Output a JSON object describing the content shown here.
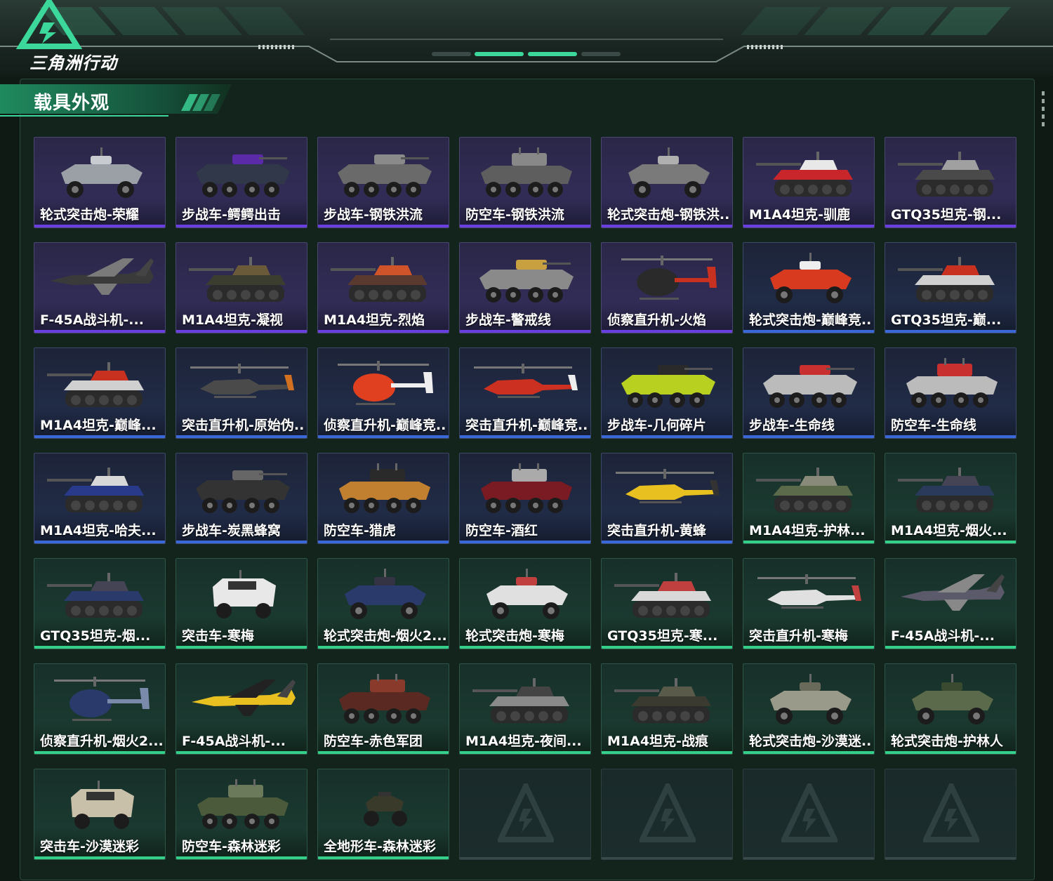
{
  "header": {
    "logo_text": "三角洲行动",
    "section_title": "载具外观"
  },
  "colors": {
    "rarity_purple": "#6a3fe0",
    "rarity_blue": "#3a68d8",
    "rarity_green": "#34d08a",
    "accent": "#3cd79a"
  },
  "items": [
    {
      "label": "轮式突击炮-荣耀",
      "rarity": "purple",
      "icon": "wheeled-assault-gun-icon"
    },
    {
      "label": "步战车-鳄鳄出击",
      "rarity": "purple",
      "icon": "ifv-icon"
    },
    {
      "label": "步战车-钢铁洪流",
      "rarity": "purple",
      "icon": "ifv-icon"
    },
    {
      "label": "防空车-钢铁洪流",
      "rarity": "purple",
      "icon": "aa-vehicle-icon"
    },
    {
      "label": "轮式突击炮-钢铁洪...",
      "rarity": "purple",
      "icon": "wheeled-assault-gun-icon"
    },
    {
      "label": "M1A4坦克-驯鹿",
      "rarity": "purple",
      "icon": "tank-icon"
    },
    {
      "label": "GTQ35坦克-钢...",
      "rarity": "purple",
      "icon": "tank-icon"
    },
    {
      "label": "F-45A战斗机-...",
      "rarity": "purple",
      "icon": "jet-icon"
    },
    {
      "label": "M1A4坦克-凝视",
      "rarity": "purple",
      "icon": "tank-icon"
    },
    {
      "label": "M1A4坦克-烈焰",
      "rarity": "purple",
      "icon": "tank-icon"
    },
    {
      "label": "步战车-警戒线",
      "rarity": "purple",
      "icon": "ifv-icon"
    },
    {
      "label": "侦察直升机-火焰",
      "rarity": "purple",
      "icon": "scout-helicopter-icon"
    },
    {
      "label": "轮式突击炮-巅峰竞...",
      "rarity": "blue",
      "icon": "wheeled-assault-gun-icon"
    },
    {
      "label": "GTQ35坦克-巅...",
      "rarity": "blue",
      "icon": "tank-icon"
    },
    {
      "label": "M1A4坦克-巅峰...",
      "rarity": "blue",
      "icon": "tank-icon"
    },
    {
      "label": "突击直升机-原始伪...",
      "rarity": "blue",
      "icon": "attack-helicopter-icon"
    },
    {
      "label": "侦察直升机-巅峰竞...",
      "rarity": "blue",
      "icon": "scout-helicopter-icon"
    },
    {
      "label": "突击直升机-巅峰竞...",
      "rarity": "blue",
      "icon": "attack-helicopter-icon"
    },
    {
      "label": "步战车-几何碎片",
      "rarity": "blue",
      "icon": "ifv-icon"
    },
    {
      "label": "步战车-生命线",
      "rarity": "blue",
      "icon": "ifv-icon"
    },
    {
      "label": "防空车-生命线",
      "rarity": "blue",
      "icon": "aa-vehicle-icon"
    },
    {
      "label": "M1A4坦克-哈夫...",
      "rarity": "blue",
      "icon": "tank-icon"
    },
    {
      "label": "步战车-炭黑蜂窝",
      "rarity": "blue",
      "icon": "ifv-icon"
    },
    {
      "label": "防空车-猎虎",
      "rarity": "blue",
      "icon": "aa-vehicle-icon"
    },
    {
      "label": "防空车-酒红",
      "rarity": "blue",
      "icon": "aa-vehicle-icon"
    },
    {
      "label": "突击直升机-黄蜂",
      "rarity": "blue",
      "icon": "attack-helicopter-icon"
    },
    {
      "label": "M1A4坦克-护林...",
      "rarity": "green",
      "icon": "tank-icon"
    },
    {
      "label": "M1A4坦克-烟火...",
      "rarity": "green",
      "icon": "tank-icon"
    },
    {
      "label": "GTQ35坦克-烟...",
      "rarity": "green",
      "icon": "tank-icon"
    },
    {
      "label": "突击车-寒梅",
      "rarity": "green",
      "icon": "assault-vehicle-icon"
    },
    {
      "label": "轮式突击炮-烟火2...",
      "rarity": "green",
      "icon": "wheeled-assault-gun-icon"
    },
    {
      "label": "轮式突击炮-寒梅",
      "rarity": "green",
      "icon": "wheeled-assault-gun-icon"
    },
    {
      "label": "GTQ35坦克-寒...",
      "rarity": "green",
      "icon": "tank-icon"
    },
    {
      "label": "突击直升机-寒梅",
      "rarity": "green",
      "icon": "attack-helicopter-icon"
    },
    {
      "label": "F-45A战斗机-...",
      "rarity": "green",
      "icon": "jet-icon"
    },
    {
      "label": "侦察直升机-烟火2...",
      "rarity": "green",
      "icon": "scout-helicopter-icon"
    },
    {
      "label": "F-45A战斗机-...",
      "rarity": "green",
      "icon": "jet-icon"
    },
    {
      "label": "防空车-赤色军团",
      "rarity": "green",
      "icon": "aa-vehicle-icon"
    },
    {
      "label": "M1A4坦克-夜间...",
      "rarity": "green",
      "icon": "tank-icon"
    },
    {
      "label": "M1A4坦克-战痕",
      "rarity": "green",
      "icon": "tank-icon"
    },
    {
      "label": "轮式突击炮-沙漠迷...",
      "rarity": "green",
      "icon": "wheeled-assault-gun-icon"
    },
    {
      "label": "轮式突击炮-护林人",
      "rarity": "green",
      "icon": "wheeled-assault-gun-icon"
    },
    {
      "label": "突击车-沙漠迷彩",
      "rarity": "green",
      "icon": "assault-vehicle-icon"
    },
    {
      "label": "防空车-森林迷彩",
      "rarity": "green",
      "icon": "aa-vehicle-icon"
    },
    {
      "label": "全地形车-森林迷彩",
      "rarity": "green",
      "icon": "atv-icon"
    },
    {
      "label": "",
      "rarity": "empty",
      "icon": "empty-slot-emblem-icon"
    },
    {
      "label": "",
      "rarity": "empty",
      "icon": "empty-slot-emblem-icon"
    },
    {
      "label": "",
      "rarity": "empty",
      "icon": "empty-slot-emblem-icon"
    },
    {
      "label": "",
      "rarity": "empty",
      "icon": "empty-slot-emblem-icon"
    }
  ]
}
